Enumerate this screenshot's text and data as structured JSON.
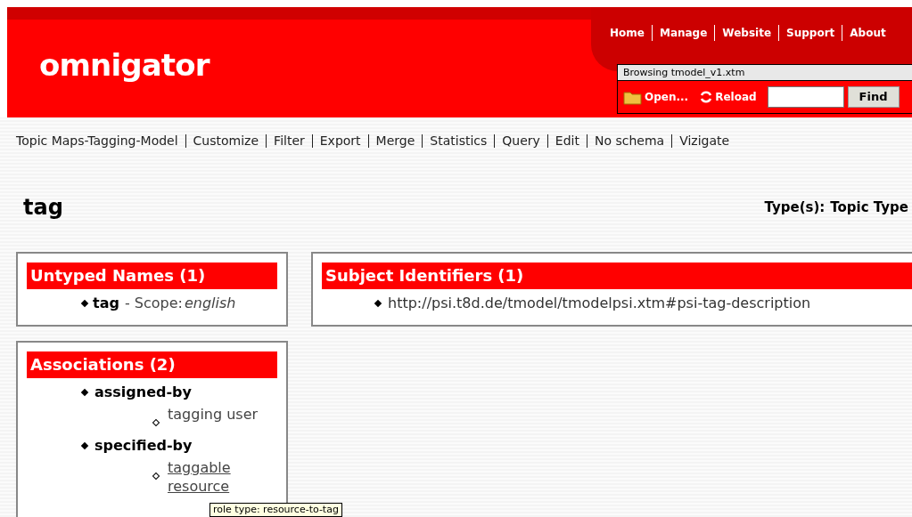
{
  "header": {
    "logo": "omnigator",
    "nav": [
      "Home",
      "Manage",
      "Website",
      "Support",
      "About"
    ],
    "browsing": "Browsing tmodel_v1.xtm",
    "open": "Open...",
    "reload": "Reload",
    "find": "Find"
  },
  "menu": [
    "Topic Maps-Tagging-Model",
    "Customize",
    "Filter",
    "Export",
    "Merge",
    "Statistics",
    "Query",
    "Edit",
    "No schema",
    "Vizigate"
  ],
  "topic": {
    "title": "tag",
    "types_label": "Type(s):",
    "types": "Topic Type"
  },
  "untyped_names": {
    "title": "Untyped Names (1)",
    "items": [
      {
        "name": "tag",
        "scope_label": "- Scope:",
        "scope": "english"
      }
    ]
  },
  "subject_identifiers": {
    "title": "Subject Identifiers (1)",
    "items": [
      "http://psi.t8d.de/tmodel/tmodelpsi.xtm#psi-tag-description"
    ]
  },
  "associations": {
    "title": "Associations (2)",
    "items": [
      {
        "label": "assigned-by",
        "children": [
          {
            "label": "tagging user",
            "hovered": false
          }
        ]
      },
      {
        "label": "specified-by",
        "children": [
          {
            "label": "taggable resource",
            "hovered": true
          }
        ]
      }
    ]
  },
  "tooltip": "role type: resource-to-tag"
}
